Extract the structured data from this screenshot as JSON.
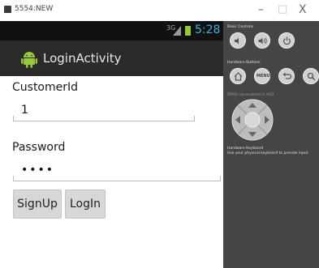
{
  "window": {
    "title": "5554:NEW",
    "minimize": "–",
    "maximize": "□",
    "close": "X"
  },
  "statusbar": {
    "network": "3G",
    "time": "5:28"
  },
  "actionbar": {
    "title": "LoginActivity",
    "icon": "android-icon"
  },
  "form": {
    "customer_label": "CustomerId",
    "customer_value": "1",
    "password_label": "Password",
    "password_value": "••••"
  },
  "buttons": {
    "signup": "SignUp",
    "login": "LogIn"
  },
  "controls": {
    "basic_heading": "Basic Controls",
    "hardware_heading": "Hardware Buttons",
    "menu_label": "MENU",
    "dpad_note": "DPAD not enabled in AVD",
    "keyboard_heading": "Hardware Keyboard",
    "keyboard_note": "Use your physical keyboard to provide input"
  },
  "colors": {
    "clock": "#33b5e5",
    "actionbar": "#2b2b2b",
    "panel": "#454545",
    "android": "#98c93c"
  }
}
